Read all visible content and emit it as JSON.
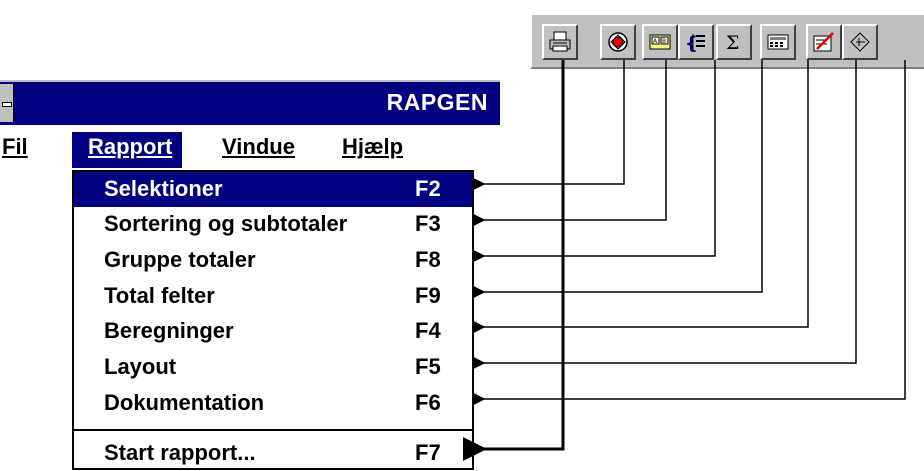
{
  "window": {
    "title": "RAPGEN"
  },
  "menubar": {
    "items": [
      {
        "label": "Fil"
      },
      {
        "label": "Rapport"
      },
      {
        "label": "Vindue"
      },
      {
        "label": "Hjælp"
      }
    ]
  },
  "dropdown": {
    "items": [
      {
        "label": "Selektioner",
        "key": "F2"
      },
      {
        "label": "Sortering og subtotaler",
        "key": "F3"
      },
      {
        "label": "Gruppe totaler",
        "key": "F8"
      },
      {
        "label": "Total felter",
        "key": "F9"
      },
      {
        "label": "Beregninger",
        "key": "F4"
      },
      {
        "label": "Layout",
        "key": "F5"
      },
      {
        "label": "Dokumentation",
        "key": "F6"
      },
      {
        "label": "Start rapport...",
        "key": "F7"
      }
    ]
  },
  "toolbar": {
    "buttons": [
      {
        "icon": "printer-icon"
      },
      {
        "icon": "selection-icon"
      },
      {
        "icon": "sort-icon"
      },
      {
        "icon": "group-totals-icon"
      },
      {
        "icon": "sum-icon"
      },
      {
        "icon": "calculator-icon"
      },
      {
        "icon": "layout-icon"
      },
      {
        "icon": "documentation-icon"
      }
    ]
  }
}
